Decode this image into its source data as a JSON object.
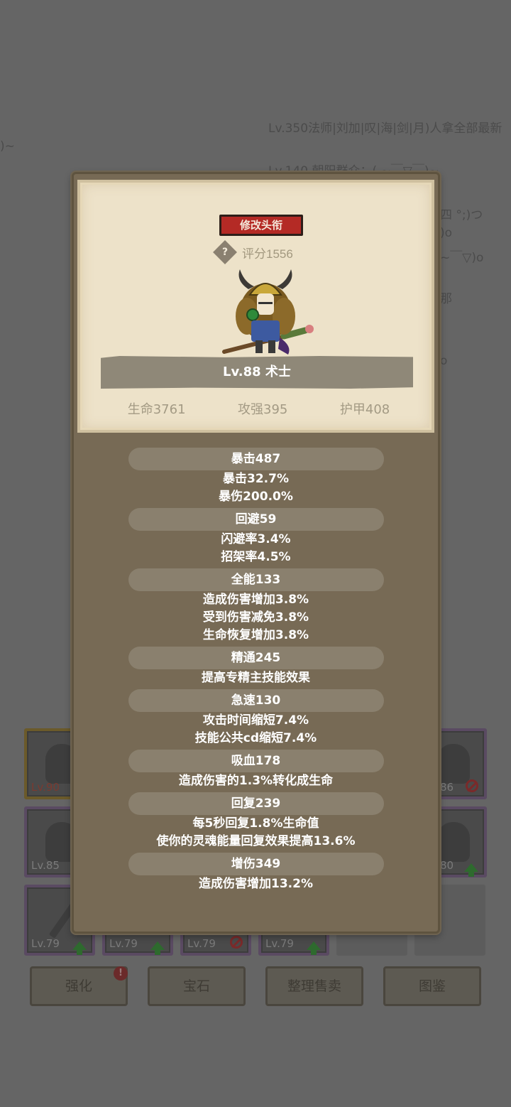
{
  "background": {
    "chat_lines": [
      "Lv.350法师|刘加|叹|海|剑|月)人拿全部最新",
      ")~",
      "Lv.140 朝阳群众：( ~￣▽￣)~",
      "四 °;)つ",
      ")o",
      "~￣▽)o",
      "那",
      "o"
    ],
    "equipment_slots": [
      {
        "level": "Lv.90",
        "state": "equipped"
      },
      {
        "level": "86",
        "state": "blocked"
      },
      {
        "level": "Lv.85",
        "state": "none"
      },
      {
        "level": "80",
        "state": "upgrade"
      },
      {
        "level": "Lv.79",
        "state": "upgrade"
      },
      {
        "level": "Lv.79",
        "state": "upgrade"
      },
      {
        "level": "Lv.79",
        "state": "blocked"
      },
      {
        "level": "Lv.79",
        "state": "upgrade"
      }
    ],
    "buttons": [
      "强化",
      "宝石",
      "整理售卖",
      "图鉴"
    ],
    "alert_badge": "!"
  },
  "profile": {
    "change_title_label": "修改头衔",
    "help_icon": "?",
    "score": "评分1556",
    "name": "Lv.88 术士",
    "base_stats": {
      "hp": "生命3761",
      "attack": "攻强395",
      "armor": "护甲408"
    }
  },
  "stats": {
    "crit": {
      "head": "暴击487",
      "lines": [
        "暴击32.7%",
        "暴伤200.0%"
      ]
    },
    "dodge": {
      "head": "回避59",
      "lines": [
        "闪避率3.4%",
        "招架率4.5%"
      ]
    },
    "versatility": {
      "head": "全能133",
      "lines": [
        "造成伤害增加3.8%",
        "受到伤害减免3.8%",
        "生命恢复增加3.8%"
      ]
    },
    "mastery": {
      "head": "精通245",
      "lines": [
        "提高专精主技能效果"
      ]
    },
    "haste": {
      "head": "急速130",
      "lines": [
        "攻击时间缩短7.4%",
        "技能公共cd缩短7.4%"
      ]
    },
    "leech": {
      "head": "吸血178",
      "lines": [
        "造成伤害的1.3%转化成生命"
      ]
    },
    "regen": {
      "head": "回复239",
      "lines": [
        "每5秒回复1.8%生命值",
        "使你的灵魂能量回复效果提高13.6%"
      ]
    },
    "dmg": {
      "head": "增伤349",
      "lines": [
        "造成伤害增加13.2%"
      ]
    }
  },
  "colors": {
    "accent_red": "#b42a25",
    "parchment": "#ede2c9",
    "panel": "#776a55"
  }
}
